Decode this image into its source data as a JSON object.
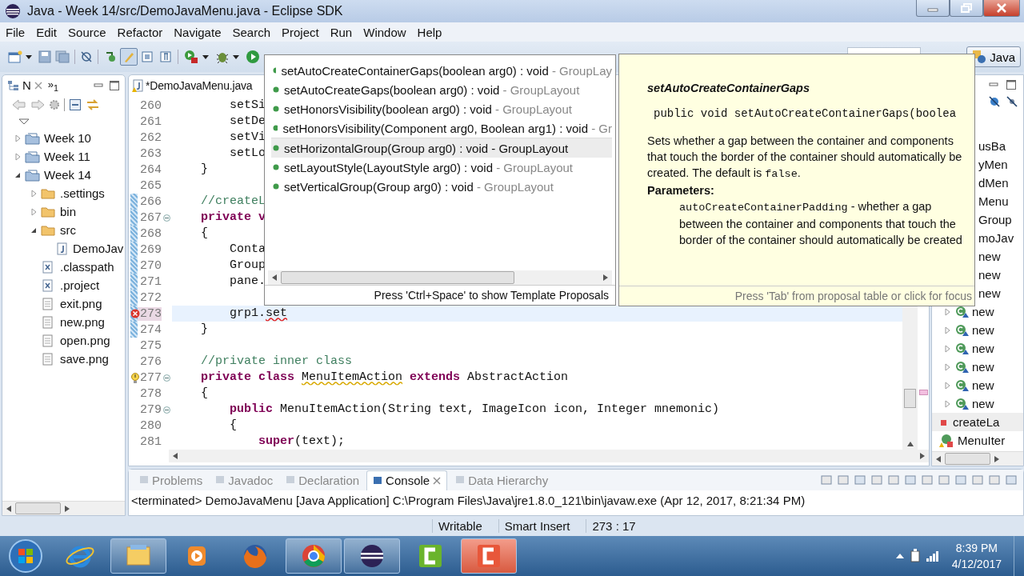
{
  "window": {
    "title": "Java - Week 14/src/DemoJavaMenu.java - Eclipse SDK"
  },
  "menu": [
    "File",
    "Edit",
    "Source",
    "Refactor",
    "Navigate",
    "Search",
    "Project",
    "Run",
    "Window",
    "Help"
  ],
  "toolbar": {
    "toggles": [
      {
        "selected": false
      },
      {
        "selected": true
      },
      {
        "selected": false
      },
      {
        "selected": false
      }
    ],
    "perspective": "Java"
  },
  "explorer": {
    "tab": "N",
    "overflow": "»$_{1}$",
    "tree": [
      {
        "label": "Week 10",
        "kind": "project",
        "expanded": false
      },
      {
        "label": "Week 11",
        "kind": "project",
        "expanded": false
      },
      {
        "label": "Week 14",
        "kind": "project",
        "expanded": true,
        "children": [
          {
            "label": ".settings",
            "kind": "folder",
            "expanded": false
          },
          {
            "label": "bin",
            "kind": "folder",
            "expanded": false
          },
          {
            "label": "src",
            "kind": "folder",
            "expanded": true,
            "children": [
              {
                "label": "DemoJav",
                "kind": "java"
              }
            ]
          },
          {
            "label": ".classpath",
            "kind": "xml"
          },
          {
            "label": ".project",
            "kind": "xml"
          },
          {
            "label": "exit.png",
            "kind": "file"
          },
          {
            "label": "new.png",
            "kind": "file"
          },
          {
            "label": "open.png",
            "kind": "file"
          },
          {
            "label": "save.png",
            "kind": "file"
          }
        ]
      }
    ]
  },
  "editor": {
    "tab": "*DemoJavaMenu.java",
    "lines": [
      {
        "num": "260",
        "changed": false,
        "foldable": false,
        "current": false,
        "segments": [
          {
            "kind": "plain",
            "text": "        setSi"
          }
        ]
      },
      {
        "num": "261",
        "changed": false,
        "foldable": false,
        "current": false,
        "segments": [
          {
            "kind": "plain",
            "text": "        setDe"
          }
        ]
      },
      {
        "num": "262",
        "changed": false,
        "foldable": false,
        "current": false,
        "segments": [
          {
            "kind": "plain",
            "text": "        setVi"
          }
        ]
      },
      {
        "num": "263",
        "changed": false,
        "foldable": false,
        "current": false,
        "segments": [
          {
            "kind": "plain",
            "text": "        setLo"
          }
        ]
      },
      {
        "num": "264",
        "changed": false,
        "foldable": false,
        "current": false,
        "segments": [
          {
            "kind": "plain",
            "text": "    }"
          }
        ]
      },
      {
        "num": "265",
        "changed": false,
        "foldable": false,
        "current": false
      },
      {
        "num": "266",
        "changed": true,
        "foldable": false,
        "current": false,
        "segments": [
          {
            "kind": "comment",
            "text": "    //createL"
          }
        ]
      },
      {
        "num": "267",
        "changed": true,
        "foldable": true,
        "current": false,
        "segments": [
          {
            "kind": "keyword",
            "text": "    private v"
          }
        ]
      },
      {
        "num": "268",
        "changed": true,
        "foldable": false,
        "current": false,
        "segments": [
          {
            "kind": "plain",
            "text": "    {"
          }
        ]
      },
      {
        "num": "269",
        "changed": true,
        "foldable": false,
        "current": false,
        "segments": [
          {
            "kind": "plain",
            "text": "        Conta"
          }
        ]
      },
      {
        "num": "270",
        "changed": true,
        "foldable": false,
        "current": false,
        "segments": [
          {
            "kind": "plain",
            "text": "        Group"
          }
        ]
      },
      {
        "num": "271",
        "changed": true,
        "foldable": false,
        "current": false,
        "segments": [
          {
            "kind": "plain",
            "text": "        pane."
          }
        ]
      },
      {
        "num": "272",
        "changed": true,
        "foldable": false,
        "current": false
      },
      {
        "num": "273",
        "changed": true,
        "foldable": false,
        "current": true,
        "kind": "error",
        "segments": [
          {
            "kind": "plain",
            "text": "        grp1."
          },
          {
            "kind": "error",
            "text": "set"
          }
        ]
      },
      {
        "num": "274",
        "changed": true,
        "foldable": false,
        "current": false,
        "segments": [
          {
            "kind": "plain",
            "text": "    }"
          }
        ]
      },
      {
        "num": "275",
        "changed": false,
        "foldable": false,
        "current": false
      },
      {
        "num": "276",
        "changed": false,
        "foldable": false,
        "current": false,
        "segments": [
          {
            "kind": "comment",
            "text": "    //private inner class"
          }
        ]
      },
      {
        "num": "277",
        "changed": false,
        "foldable": true,
        "current": false,
        "kind": "warning",
        "segments": [
          {
            "kind": "keyword",
            "text": "    private class "
          },
          {
            "kind": "warning",
            "text": "MenuItemAction"
          },
          {
            "kind": "keyword",
            "text": " extends"
          },
          {
            "kind": "plain",
            "text": " AbstractAction"
          }
        ]
      },
      {
        "num": "278",
        "changed": false,
        "foldable": false,
        "current": false,
        "segments": [
          {
            "kind": "plain",
            "text": "    {"
          }
        ]
      },
      {
        "num": "279",
        "changed": false,
        "foldable": true,
        "current": false,
        "segments": [
          {
            "kind": "keyword",
            "text": "        public"
          },
          {
            "kind": "plain",
            "text": " MenuItemAction(String text, ImageIcon icon, Integer mnemonic)"
          }
        ]
      },
      {
        "num": "280",
        "changed": false,
        "foldable": false,
        "current": false,
        "segments": [
          {
            "kind": "plain",
            "text": "        {"
          }
        ]
      },
      {
        "num": "281",
        "changed": false,
        "foldable": false,
        "current": false,
        "segments": [
          {
            "kind": "keyword",
            "text": "            super"
          },
          {
            "kind": "plain",
            "text": "(text);"
          }
        ]
      }
    ]
  },
  "proposals": {
    "items": [
      {
        "signature": "setAutoCreateContainerGaps(boolean arg0) : void",
        "owner": " - GroupLay",
        "selected": false
      },
      {
        "signature": "setAutoCreateGaps(boolean arg0) : void",
        "owner": " - GroupLayout",
        "selected": false
      },
      {
        "signature": "setHonorsVisibility(boolean arg0) : void",
        "owner": " - GroupLayout",
        "selected": false
      },
      {
        "signature": "setHonorsVisibility(Component arg0, Boolean arg1) : void",
        "owner": " - Gr",
        "selected": false
      },
      {
        "signature": "setHorizontalGroup(Group arg0) : void",
        "owner": " - GroupLayout",
        "selected": true
      },
      {
        "signature": "setLayoutStyle(LayoutStyle arg0) : void",
        "owner": " - GroupLayout",
        "selected": false
      },
      {
        "signature": "setVerticalGroup(Group arg0) : void",
        "owner": " - GroupLayout",
        "selected": false
      }
    ],
    "footer": "Press 'Ctrl+Space' to show Template Proposals"
  },
  "javadoc": {
    "title": "setAutoCreateContainerGaps",
    "signature": "public void setAutoCreateContainerGaps(boolea",
    "description": [
      {
        "code": false,
        "text": "Sets whether a gap between the container and components that touch the border of the container should automatically be created. The default is "
      },
      {
        "code": true,
        "text": "false"
      },
      {
        "code": false,
        "text": "."
      }
    ],
    "parameters_label": "Parameters:",
    "parameter": [
      {
        "code": true,
        "text": "autoCreateContainerPadding"
      },
      {
        "code": false,
        "text": " - whether a gap between the container and components that touch the border of the container should automatically be created"
      }
    ],
    "footer": "Press 'Tab' from proposal table or click for focus"
  },
  "outline": {
    "items": [
      {
        "kind": "fragment",
        "label": "usBa"
      },
      {
        "kind": "fragment",
        "label": "yMen"
      },
      {
        "kind": "fragment",
        "label": "dMen"
      },
      {
        "kind": "fragment",
        "label": "Menu"
      },
      {
        "kind": "fragment",
        "label": "Group"
      },
      {
        "kind": "fragment",
        "label": "moJav"
      },
      {
        "kind": "fragment",
        "label": "new"
      },
      {
        "kind": "fragment",
        "label": "new"
      },
      {
        "kind": "fragment",
        "label": "new"
      },
      {
        "kind": "anon",
        "label": "new"
      },
      {
        "kind": "anon",
        "label": "new"
      },
      {
        "kind": "anon",
        "label": "new"
      },
      {
        "kind": "anon",
        "label": "new"
      },
      {
        "kind": "anon",
        "label": "new"
      },
      {
        "kind": "anon",
        "label": "new"
      },
      {
        "kind": "method",
        "label": "createLa"
      },
      {
        "kind": "class",
        "label": "MenuIter"
      }
    ]
  },
  "bottom": {
    "tabs": [
      {
        "label": "Problems",
        "selected": false
      },
      {
        "label": "Javadoc",
        "selected": false
      },
      {
        "label": "Declaration",
        "selected": false
      },
      {
        "label": "Console",
        "selected": true
      },
      {
        "label": "Data Hierarchy",
        "selected": false
      }
    ],
    "console": "<terminated> DemoJavaMenu [Java Application] C:\\Program Files\\Java\\jre1.8.0_121\\bin\\javaw.exe (Apr 12, 2017, 8:21:34 PM)"
  },
  "status_bar": [
    "Writable",
    "Smart Insert",
    "273 : 17"
  ],
  "taskbar": {
    "apps": [
      {
        "kind": "ie",
        "running": false
      },
      {
        "kind": "explorer",
        "running": true
      },
      {
        "kind": "media",
        "running": false
      },
      {
        "kind": "firefox",
        "running": false
      },
      {
        "kind": "chrome",
        "running": true
      },
      {
        "kind": "eclipse",
        "running": true
      },
      {
        "kind": "camtasia",
        "running": false
      },
      {
        "kind": "recorder",
        "running": true
      }
    ],
    "time": "8:39 PM",
    "date": "4/12/2017"
  }
}
